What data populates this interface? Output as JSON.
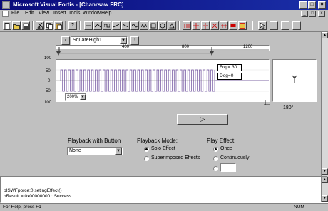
{
  "window": {
    "title": "Microsoft Visual Fortis - [Chanrsaw FRC]",
    "controls": [
      "_",
      "□",
      "×"
    ]
  },
  "menu": [
    "File",
    "Edit",
    "View",
    "Insert",
    "Tools",
    "Window",
    "Help"
  ],
  "mdi_controls": [
    "_",
    "□",
    "×"
  ],
  "toolbar": {
    "icons": [
      "new-file-icon",
      "open-folder-icon",
      "save-icon",
      "cut-icon",
      "copy-icon",
      "paste-icon",
      "help-icon"
    ]
  },
  "effect_selector": {
    "value": "SquareHigh1"
  },
  "timeline": {
    "ticks": [
      "400",
      "800",
      "1200"
    ]
  },
  "plot": {
    "y_ticks": [
      "100",
      "50",
      "0",
      "50",
      "100"
    ],
    "frq_label": "Frq = 30",
    "deg_label": "Deg=0",
    "zoom": "200%"
  },
  "direction": {
    "angle": "180°"
  },
  "play_button_symbol": "▷",
  "playback_button": {
    "heading": "Playback with Button",
    "value": "None"
  },
  "playback_mode": {
    "heading": "Playback Mode:",
    "options": [
      "Solo Effect",
      "Superimposed Effects"
    ],
    "selected": 0
  },
  "play_effect": {
    "heading": "Play Effect:",
    "options": [
      "Once",
      "Continuously"
    ],
    "selected": 0
  },
  "output": {
    "lines": [
      "pISWFporce:0.setingEffect()",
      "hResult = 0x00000000 : Success"
    ]
  },
  "status": {
    "left": "For Help, press F1",
    "right": "NUM"
  }
}
